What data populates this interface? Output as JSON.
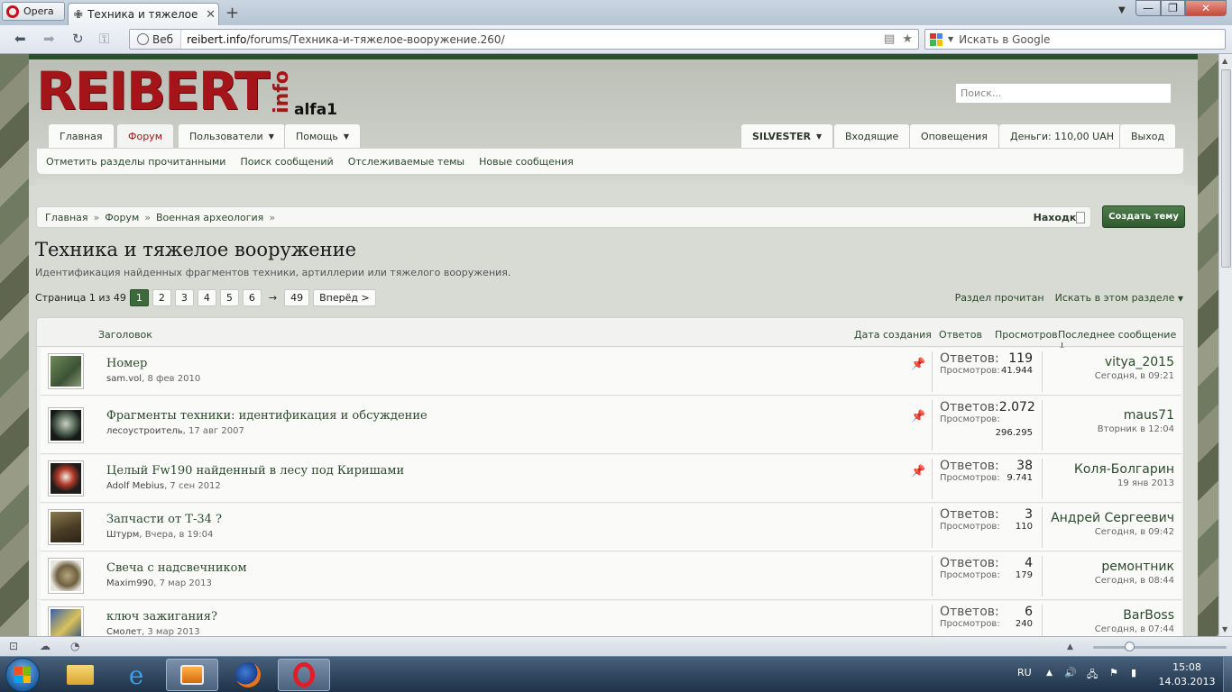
{
  "browser": {
    "menu_label": "Opera",
    "tab_title": "Техника и тяжелое во...",
    "tab_close": "✕",
    "new_tab": "+",
    "address_prefix": "Веб",
    "url_host": "reibert.info",
    "url_path": "/forums/Техника-и-тяжелое-вооружение.260/",
    "search_placeholder": "Искать в Google"
  },
  "site": {
    "logo_text": "REIBERT",
    "logo_suffix": "info",
    "user_tag": "alfa1",
    "search_placeholder": "Поиск...",
    "brand_color": "#a31518",
    "accent_color": "#2c4f2b"
  },
  "nav": {
    "tabs": [
      {
        "label": "Главная"
      },
      {
        "label": "Форум"
      },
      {
        "label": "Пользователи"
      },
      {
        "label": "Помощь"
      }
    ],
    "account": [
      {
        "label": "SILVESTER"
      },
      {
        "label": "Входящие"
      },
      {
        "label": "Оповещения"
      },
      {
        "label": "Деньги: 110,00 UAH"
      },
      {
        "label": "Выход"
      }
    ],
    "subnav": [
      "Отметить разделы прочитанными",
      "Поиск сообщений",
      "Отслеживаемые темы",
      "Новые сообщения"
    ]
  },
  "breadcrumb": [
    "Главная",
    "Форум",
    "Военная археология",
    "Находки"
  ],
  "create_button": "Создать тему",
  "forum": {
    "title": "Техника и тяжелое вооружение",
    "description": "Идентификация найденных фрагментов техники, артиллерии или тяжелого вооружения."
  },
  "pager": {
    "label": "Страница 1 из 49",
    "pages": [
      "1",
      "2",
      "3",
      "4",
      "5",
      "6"
    ],
    "arrow": "→",
    "last": "49",
    "next": "Вперёд >"
  },
  "tools": {
    "mark_read": "Раздел прочитан",
    "search_here": "Искать в этом разделе"
  },
  "columns": {
    "title": "Заголовок",
    "created": "Дата создания",
    "replies": "Ответов",
    "views": "Просмотров",
    "last": "Последнее сообщение ↓"
  },
  "labels": {
    "replies": "Ответов:",
    "views": "Просмотров:"
  },
  "threads": [
    {
      "title": "Номер",
      "author": "sam.vol",
      "date": "8 фев 2010",
      "sticky": true,
      "replies": "119",
      "views": "41.944",
      "last_user": "vitya_2015",
      "last_date": "Сегодня, в 09:21"
    },
    {
      "title": "Фрагменты техники: идентификация и обсуждение",
      "author": "лесоустроитель",
      "date": "17 авг 2007",
      "sticky": true,
      "replies": "2.072",
      "views": "296.295",
      "last_user": "maus71",
      "last_date": "Вторник в 12:04"
    },
    {
      "title": "Целый Fw190 найденный в лесу под Киришами",
      "author": "Adolf Mebius",
      "date": "7 сен 2012",
      "sticky": true,
      "replies": "38",
      "views": "9.741",
      "last_user": "Коля-Болгарин",
      "last_date": "19 янв 2013"
    },
    {
      "title": "Запчасти от Т-34 ?",
      "author": "Штурм",
      "date": "Вчера, в 19:04",
      "sticky": false,
      "replies": "3",
      "views": "110",
      "last_user": "Андрей Сергеевич",
      "last_date": "Сегодня, в 09:42"
    },
    {
      "title": "Свеча с надсвечником",
      "author": "Maxim990",
      "date": "7 мар 2013",
      "sticky": false,
      "replies": "4",
      "views": "179",
      "last_user": "ремонтник",
      "last_date": "Сегодня, в 08:44"
    },
    {
      "title": "ключ зажигания?",
      "author": "Смолет",
      "date": "3 мар 2013",
      "sticky": false,
      "replies": "6",
      "views": "240",
      "last_user": "BarBoss",
      "last_date": "Сегодня, в 07:44"
    }
  ],
  "taskbar": {
    "lang": "RU",
    "time": "15:08",
    "date": "14.03.2013"
  }
}
